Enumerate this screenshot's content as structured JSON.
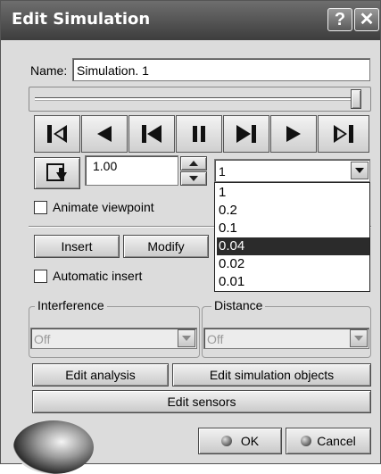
{
  "window": {
    "title": "Edit Simulation",
    "help_glyph": "?",
    "close_glyph": "✕"
  },
  "name_field": {
    "label": "Name:",
    "value": "Simulation. 1"
  },
  "player": {
    "slider_position_percent": 100,
    "buttons": [
      {
        "name": "jump-to-start",
        "icon": "skip-to-start-icon"
      },
      {
        "name": "step-backward",
        "icon": "play-backward-icon"
      },
      {
        "name": "step-back-one",
        "icon": "step-back-icon"
      },
      {
        "name": "pause",
        "icon": "pause-icon"
      },
      {
        "name": "step-forward-one",
        "icon": "step-forward-icon"
      },
      {
        "name": "play-forward",
        "icon": "play-icon"
      },
      {
        "name": "jump-to-end",
        "icon": "skip-to-end-icon"
      }
    ]
  },
  "step": {
    "value": "1.00",
    "selected": "1",
    "options": [
      "1",
      "0.2",
      "0.1",
      "0.04",
      "0.02",
      "0.01"
    ],
    "highlighted": "0.04"
  },
  "animate_viewpoint": {
    "label": "Animate viewpoint",
    "checked": false
  },
  "actions": {
    "insert": "Insert",
    "modify": "Modify"
  },
  "automatic_insert": {
    "label": "Automatic insert",
    "checked": false
  },
  "interference": {
    "title": "Interference",
    "value": "Off"
  },
  "distance": {
    "title": "Distance",
    "value": "Off"
  },
  "buttons": {
    "edit_analysis": "Edit analysis",
    "edit_simulation_objects": "Edit simulation objects",
    "edit_sensors": "Edit sensors",
    "ok": "OK",
    "cancel": "Cancel"
  },
  "colors": {
    "titlebar": "#4a4a4a",
    "dialog": "#dcdcdc",
    "highlight": "#2b2b2b"
  }
}
